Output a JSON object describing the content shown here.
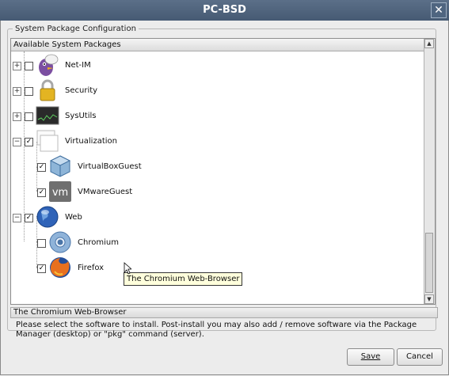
{
  "window": {
    "title": "PC-BSD",
    "close_icon": "close-icon"
  },
  "group": {
    "legend": "System Package Configuration"
  },
  "tree": {
    "header": "Available System Packages",
    "items": [
      {
        "label": "Net-IM",
        "checked": false,
        "expander": "+",
        "icon": "pidgin-icon"
      },
      {
        "label": "Security",
        "checked": false,
        "expander": "+",
        "icon": "padlock-icon"
      },
      {
        "label": "SysUtils",
        "checked": false,
        "expander": "+",
        "icon": "system-monitor-icon"
      },
      {
        "label": "Virtualization",
        "checked": true,
        "expander": "-",
        "icon": "windows-icon"
      },
      {
        "label": "VirtualBoxGuest",
        "checked": true,
        "icon": "virtualbox-icon"
      },
      {
        "label": "VMwareGuest",
        "checked": true,
        "icon": "vmware-icon"
      },
      {
        "label": "Web",
        "checked": true,
        "expander": "-",
        "icon": "globe-icon"
      },
      {
        "label": "Chromium",
        "checked": false,
        "icon": "chromium-icon"
      },
      {
        "label": "Firefox",
        "checked": true,
        "icon": "firefox-icon"
      }
    ]
  },
  "tooltip": "The Chromium Web-Browser",
  "description": "The Chromium Web-Browser",
  "hint": "Please select the software to install. Post-install you may also add / remove software via the Package Manager (desktop) or \"pkg\" command (server).",
  "buttons": {
    "save": "Save",
    "cancel": "Cancel"
  },
  "vm_text": "vm"
}
